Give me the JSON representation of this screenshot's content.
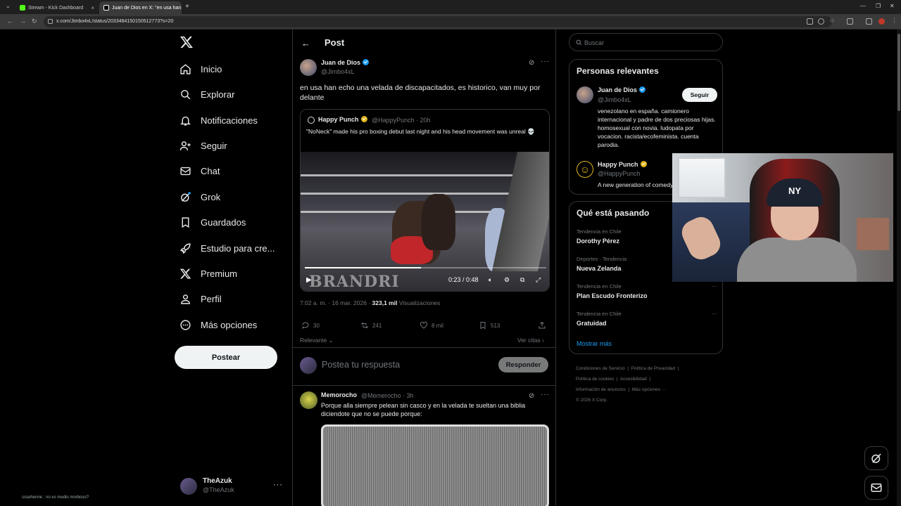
{
  "browser": {
    "tabs": [
      {
        "title": "Stream - Kick Dashboard"
      },
      {
        "title": "Juan de Dios en X: \"en usa han"
      }
    ],
    "url": "x.com/Jimbo4xL/status/2033484150150512773?s=20"
  },
  "nav": {
    "items": [
      {
        "label": "Inicio",
        "icon": "home-icon"
      },
      {
        "label": "Explorar",
        "icon": "search-icon"
      },
      {
        "label": "Notificaciones",
        "icon": "bell-icon"
      },
      {
        "label": "Seguir",
        "icon": "person-add-icon"
      },
      {
        "label": "Chat",
        "icon": "mail-icon"
      },
      {
        "label": "Grok",
        "icon": "grok-icon"
      },
      {
        "label": "Guardados",
        "icon": "bookmark-icon"
      },
      {
        "label": "Estudio para cre...",
        "icon": "rocket-icon"
      },
      {
        "label": "Premium",
        "icon": "x-logo-icon"
      },
      {
        "label": "Perfil",
        "icon": "person-icon"
      },
      {
        "label": "Más opciones",
        "icon": "more-circle-icon"
      }
    ],
    "post_button": "Postear",
    "account": {
      "name": "TheAzuk",
      "handle": "@TheAzuk"
    }
  },
  "chat_overlay": "sssehenne : no es medio morboso?",
  "main": {
    "header": "Post",
    "tweet": {
      "author": "Juan de Dios",
      "handle": "@Jimbo4xL",
      "text": "en usa han echo una velada de discapacitados, es historico, van muy por delante",
      "quote": {
        "author": "Happy Punch",
        "meta": "@HappyPunch · 20h",
        "text": "\"NoNeck\" made his pro boxing debut last night and his head movement was unreal 💀",
        "video": {
          "time": "0:23 / 0:48",
          "progress": 0.48,
          "banner": "BRANDRI"
        }
      },
      "timestamp": "7:02 a. m. · 16 mar. 2026 ·",
      "views_count": "323,1 mil",
      "views_label": "Visualizaciones",
      "stats": {
        "replies": "30",
        "reposts": "241",
        "likes": "8 mil",
        "bookmarks": "513"
      }
    },
    "sort_label": "Relevante",
    "quotes_link": "Ver citas",
    "reply_placeholder": "Postea tu respuesta",
    "reply_button": "Responder",
    "reply": {
      "author": "Memorocho",
      "meta": "@Memerocho · 3h",
      "text": "Porque alla siempre pelean sin casco y en la velada te sueltan una biblia diciendote que no se puede porque:"
    }
  },
  "sidebar": {
    "search_placeholder": "Buscar",
    "relevant_title": "Personas relevantes",
    "people": [
      {
        "name": "Juan de Dios",
        "handle": "@Jimbo4xL",
        "bio": "venezolano en españa. camionero internacional y padre de dos preciosas hijas. homosexual con novia. ludopata por vocacion. racista/ecofeminista. cuenta parodia.",
        "button": "Seguir"
      },
      {
        "name": "Happy Punch",
        "handle": "@HappyPunch",
        "bio": "A new generation of comedy"
      }
    ],
    "trends_title": "Qué está pasando",
    "trends": [
      {
        "context": "Tendencia en Chile",
        "title": "Dorothy Pérez"
      },
      {
        "context": "Deportes · Tendencia",
        "title": "Nueva Zelanda"
      },
      {
        "context": "Tendencia en Chile",
        "title": "Plan Escudo Fronterizo"
      },
      {
        "context": "Tendencia en Chile",
        "title": "Gratuidad"
      }
    ],
    "show_more": "Mostrar más",
    "footer": {
      "links": [
        "Condiciones de Servicio",
        "Política de Privacidad",
        "Política de cookies",
        "Accesibilidad",
        "Información de anuncios",
        "Más opciones ···"
      ],
      "copyright": "© 2026 X Corp."
    }
  },
  "colors": {
    "accent": "#1d9bf0",
    "background": "#000000",
    "border": "#2f3336",
    "muted": "#71767b"
  }
}
